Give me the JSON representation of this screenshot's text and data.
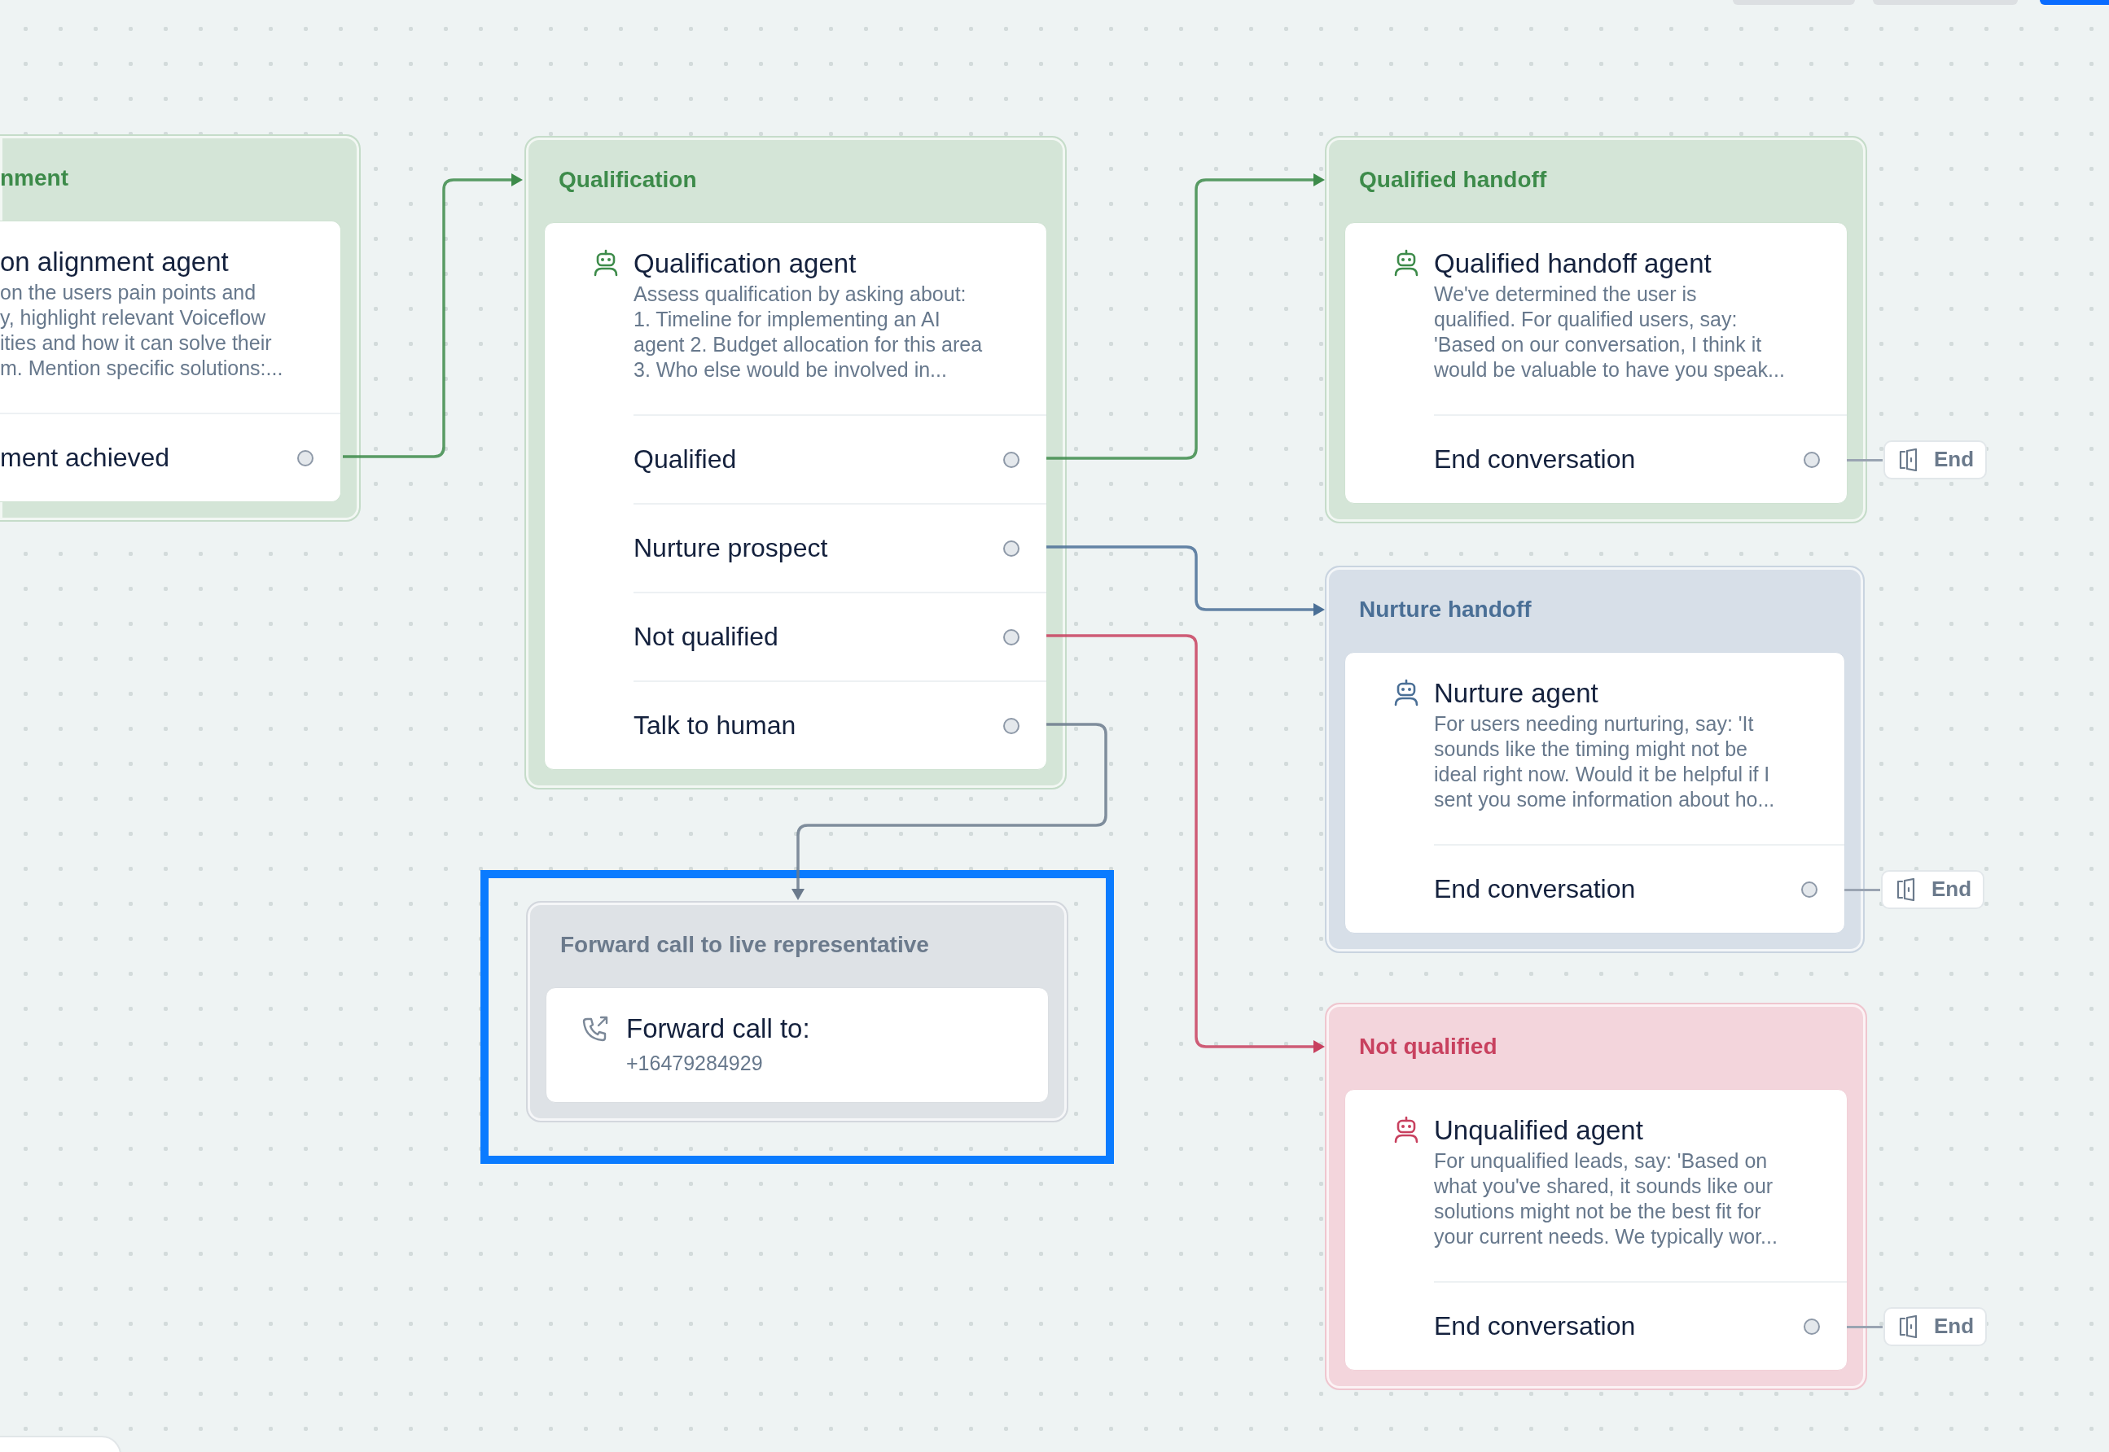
{
  "canvas": {
    "nodes": [
      {
        "kind": "agent",
        "title": "nment",
        "color": "#3d8b4a",
        "selected": false,
        "agent": "on alignment agent",
        "description_lines": [
          "on the users pain points and",
          "y, highlight relevant Voiceflow",
          "ities and how it can solve their",
          "m. Mention specific solutions:..."
        ],
        "ports": [
          {
            "label": "ment achieved"
          }
        ]
      },
      {
        "kind": "agent",
        "title": "Qualification",
        "color": "#3d8b4a",
        "selected": false,
        "agent": "Qualification agent",
        "description_lines": [
          "Assess qualification by asking about:",
          "1. Timeline for implementing an AI",
          "agent 2. Budget allocation for this area",
          "3. Who else would be involved in..."
        ],
        "ports": [
          {
            "label": "Qualified"
          },
          {
            "label": "Nurture prospect"
          },
          {
            "label": "Not qualified"
          },
          {
            "label": "Talk to human"
          }
        ]
      },
      {
        "kind": "agent",
        "title": "Qualified handoff",
        "color": "#3d8b4a",
        "selected": false,
        "agent": "Qualified handoff agent",
        "description_lines": [
          "We've determined the user is",
          "qualified. For qualified users, say:",
          "'Based on our conversation, I think it",
          "would be valuable to have you speak..."
        ],
        "ports": [
          {
            "label": "End conversation",
            "end_label": "End"
          }
        ]
      },
      {
        "kind": "agent",
        "title": "Nurture handoff",
        "color": "#4a6f96",
        "selected": false,
        "agent": "Nurture agent",
        "description_lines": [
          "For users needing nurturing, say: 'It",
          "sounds like the timing might not be",
          "ideal right now. Would it be helpful if I",
          "sent you some information about ho..."
        ],
        "ports": [
          {
            "label": "End conversation",
            "end_label": "End"
          }
        ]
      },
      {
        "kind": "agent",
        "title": "Not qualified",
        "color": "#c8415f",
        "selected": false,
        "agent": "Unqualified agent",
        "description_lines": [
          "For unqualified leads, say: 'Based on",
          "what you've shared, it sounds like our",
          "solutions might not be the best fit for",
          "your current needs. We typically wor..."
        ],
        "ports": [
          {
            "label": "End conversation",
            "end_label": "End"
          }
        ]
      },
      {
        "kind": "forward",
        "title": "Forward call to live representative",
        "color": "#6b7a8c",
        "selected": true,
        "action": "Forward call to:",
        "number": "+16479284929"
      }
    ]
  }
}
